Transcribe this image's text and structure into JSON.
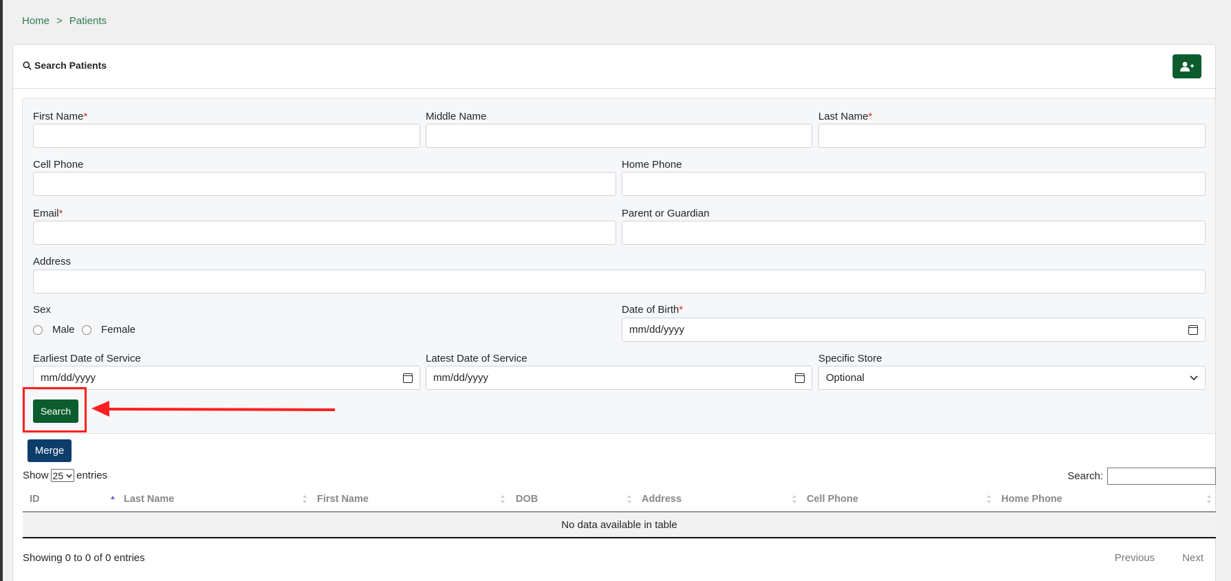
{
  "breadcrumb": {
    "home": "Home",
    "separator": ">",
    "current": "Patients"
  },
  "card": {
    "title": "Search Patients",
    "add_icon": "user-plus-icon"
  },
  "form": {
    "first_name": {
      "label": "First Name",
      "required": "*",
      "value": ""
    },
    "middle_name": {
      "label": "Middle Name",
      "value": ""
    },
    "last_name": {
      "label": "Last Name",
      "required": "*",
      "value": ""
    },
    "cell_phone": {
      "label": "Cell Phone",
      "value": ""
    },
    "home_phone": {
      "label": "Home Phone",
      "value": ""
    },
    "email": {
      "label": "Email",
      "required": "*",
      "value": ""
    },
    "guardian": {
      "label": "Parent or Guardian",
      "value": ""
    },
    "address": {
      "label": "Address",
      "value": ""
    },
    "sex": {
      "label": "Sex",
      "male": "Male",
      "female": "Female"
    },
    "dob": {
      "label": "Date of Birth",
      "required": "*",
      "placeholder": "mm/dd/yyyy"
    },
    "earliest": {
      "label": "Earliest Date of Service",
      "placeholder": "mm/dd/yyyy"
    },
    "latest": {
      "label": "Latest Date of Service",
      "placeholder": "mm/dd/yyyy"
    },
    "store": {
      "label": "Specific Store",
      "selected": "Optional"
    },
    "search_label": "Search"
  },
  "merge_label": "Merge",
  "table": {
    "show_label": "Show",
    "page_size": "25",
    "entries_label": "entries",
    "search_label": "Search:",
    "columns": [
      "ID",
      "Last Name",
      "First Name",
      "DOB",
      "Address",
      "Cell Phone",
      "Home Phone"
    ],
    "empty_message": "No data available in table",
    "info": "Showing 0 to 0 of 0 entries",
    "prev": "Previous",
    "next": "Next"
  },
  "colors": {
    "primary_green": "#0d5c2e",
    "merge_blue": "#0c3d6b",
    "annotation_red": "#ff2020",
    "required_red": "#d32f2f"
  }
}
